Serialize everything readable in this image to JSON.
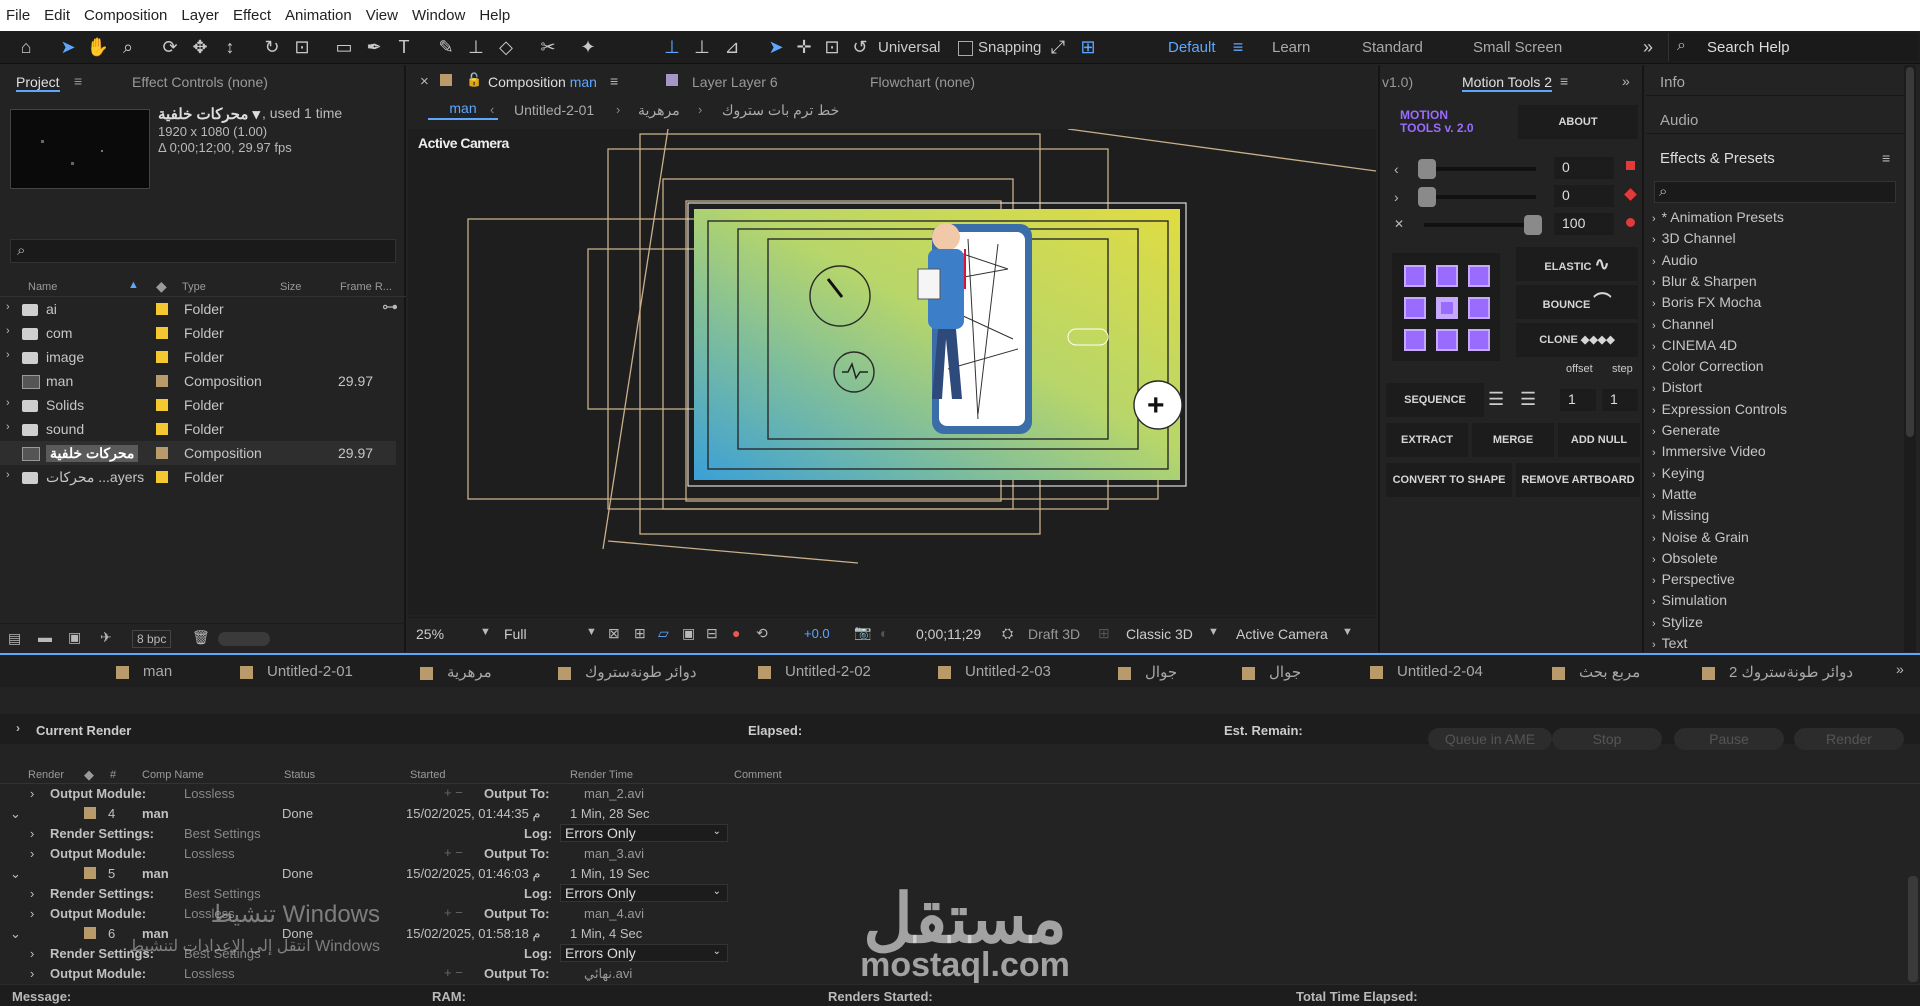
{
  "menu": [
    "File",
    "Edit",
    "Composition",
    "Layer",
    "Effect",
    "Animation",
    "View",
    "Window",
    "Help"
  ],
  "toolbar": {
    "universal": "Universal",
    "snapping": "Snapping",
    "workspaces": [
      "Default",
      "Learn",
      "Standard",
      "Small Screen"
    ],
    "search_help": "Search Help"
  },
  "project": {
    "tab": "Project",
    "effect_controls": "Effect Controls (none)",
    "comp_name": "محركات خلفية ▾",
    "used": ", used 1 time",
    "dims": "1920 x 1080 (1.00)",
    "duration": "Δ 0;00;12;00, 29.97 fps",
    "columns": [
      "Name",
      "Type",
      "Size",
      "Frame R..."
    ],
    "items": [
      {
        "name": "ai",
        "type": "Folder",
        "fps": ""
      },
      {
        "name": "com",
        "type": "Folder",
        "fps": ""
      },
      {
        "name": "image",
        "type": "Folder",
        "fps": ""
      },
      {
        "name": "man",
        "type": "Composition",
        "fps": "29.97"
      },
      {
        "name": "Solids",
        "type": "Folder",
        "fps": ""
      },
      {
        "name": "sound",
        "type": "Folder",
        "fps": ""
      },
      {
        "name": "محركات خلفية",
        "type": "Composition",
        "fps": "29.97"
      },
      {
        "name": "محركات ...ayers",
        "type": "Folder",
        "fps": ""
      }
    ],
    "bpc": "8 bpc"
  },
  "composition": {
    "tab_label": "Composition",
    "tab_name": "man",
    "layer_tab": "Layer  Layer 6",
    "flowchart_tab": "Flowchart  (none)",
    "breadcrumb": [
      "man",
      "Untitled-2-01",
      "مرهرية",
      "خط ترم بات ستروك"
    ],
    "active_camera": "Active Camera",
    "zoom": "25%",
    "resolution": "Full",
    "exposure": "+0.0",
    "timecode": "0;00;11;29",
    "draft3d": "Draft 3D",
    "renderer": "Classic 3D",
    "camera": "Active Camera"
  },
  "motion_tools": {
    "prev_tab": "v1.0)",
    "tab": "Motion Tools 2",
    "logo": "MOTION TOOLS v. 2.0",
    "about": "ABOUT",
    "values": [
      "0",
      "0",
      "100"
    ],
    "elastic": "ELASTIC",
    "bounce": "BOUNCE",
    "clone": "CLONE",
    "offset": "offset",
    "step": "step",
    "sequence": "SEQUENCE",
    "seq_vals": [
      "1",
      "1"
    ],
    "extract": "EXTRACT",
    "merge": "MERGE",
    "add_null": "ADD NULL",
    "convert": "CONVERT TO SHAPE",
    "remove_artboard": "REMOVE ARTBOARD"
  },
  "right_panel": {
    "info": "Info",
    "audio": "Audio",
    "effects_presets": "Effects & Presets",
    "effects": [
      "* Animation Presets",
      "3D Channel",
      "Audio",
      "Blur & Sharpen",
      "Boris FX Mocha",
      "Channel",
      "CINEMA 4D",
      "Color Correction",
      "Distort",
      "Expression Controls",
      "Generate",
      "Immersive Video",
      "Keying",
      "Matte",
      "Missing",
      "Noise & Grain",
      "Obsolete",
      "Perspective",
      "Simulation",
      "Stylize",
      "Text"
    ]
  },
  "queue_tabs": [
    "man",
    "Untitled-2-01",
    "مرهرية",
    "دوائر طونةستروك",
    "Untitled-2-02",
    "Untitled-2-03",
    "جوال",
    "جوال",
    "Untitled-2-04",
    "مربع بحث",
    "2 دوائر طونةستروك"
  ],
  "render_queue": {
    "current_render": "Current Render",
    "elapsed": "Elapsed:",
    "est_remain": "Est. Remain:",
    "buttons": [
      "Queue in AME",
      "Stop",
      "Pause",
      "Render"
    ],
    "columns": [
      "Render",
      "#",
      "Comp Name",
      "Status",
      "Started",
      "Render Time",
      "Comment"
    ],
    "output_module_label": "Output Module:",
    "render_settings_label": "Render Settings:",
    "output_to_label": "Output To:",
    "log_label": "Log:",
    "lossless": "Lossless",
    "best_settings": "Best Settings",
    "errors_only": "Errors Only",
    "first_output": "man_2.avi",
    "items": [
      {
        "num": "4",
        "comp": "man",
        "status": "Done",
        "started": "15/02/2025,  01:44:35 م",
        "time": "1 Min, 28 Sec",
        "output": "man_3.avi"
      },
      {
        "num": "5",
        "comp": "man",
        "status": "Done",
        "started": "15/02/2025,  01:46:03 م",
        "time": "1 Min, 19 Sec",
        "output": "man_4.avi"
      },
      {
        "num": "6",
        "comp": "man",
        "status": "Done",
        "started": "15/02/2025,  01:58:18 م",
        "time": "1 Min, 4 Sec",
        "output": "نهائي.avi"
      }
    ]
  },
  "status_bar": {
    "message": "Message:",
    "ram": "RAM:",
    "renders_started": "Renders Started:",
    "total_elapsed": "Total Time Elapsed:"
  },
  "watermark": {
    "activate_title": "تنشيط Windows",
    "activate_sub": "انتقل إلى الإعدادات لتنشيط Windows",
    "logo_ar": "مستقل",
    "logo_en": "mostaql.com"
  }
}
